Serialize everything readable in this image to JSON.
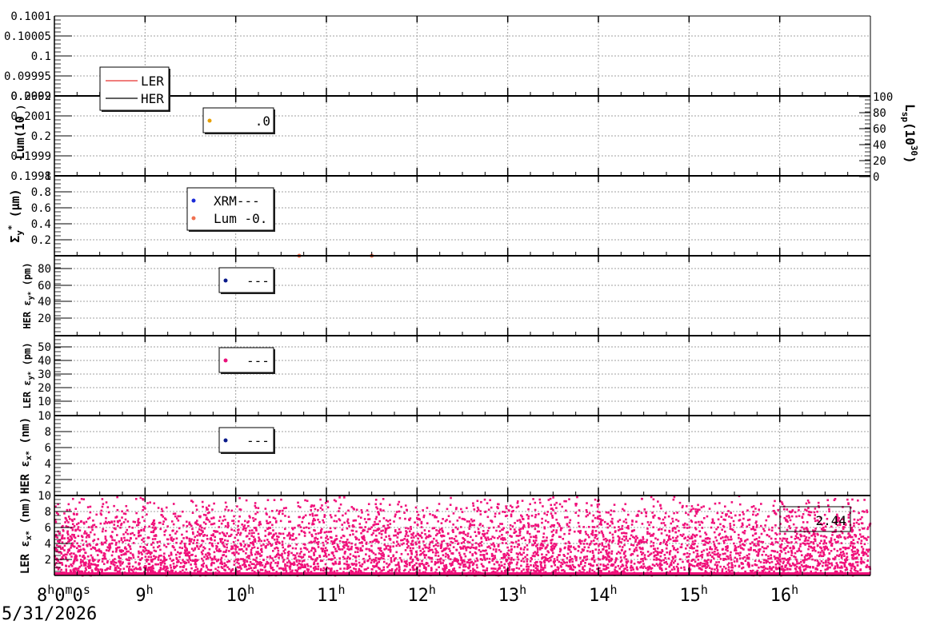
{
  "chart_data": {
    "type": "scatter",
    "x_axis": {
      "tick_labels": [
        "8",
        "9",
        "10",
        "11",
        "12",
        "13",
        "14",
        "15",
        "16"
      ],
      "first_label_suffix": "0m0s",
      "hour_unit": "h",
      "range_hours": [
        8,
        17
      ],
      "date": "5/31/2026"
    },
    "panels": [
      {
        "id": "p1",
        "ylabel": "",
        "yticks": [
          "0.1001",
          "0.10005",
          "0.1",
          "0.09995",
          "0.0999"
        ],
        "legend": {
          "entries": [
            {
              "label": "LER",
              "color": "#e8322d"
            },
            {
              "label": "HER",
              "color": "#000000"
            }
          ]
        }
      },
      {
        "id": "p2",
        "ylabel": "Lum(10",
        "ylabel_exp": "",
        "yticks": [
          "0.2002",
          "0.2001",
          "0.2",
          "0.1999",
          "0.1998"
        ],
        "right_axis": {
          "label_main": "L",
          "label_sub": "sp",
          "label_tail": "(10",
          "label_exp": "30",
          "label_end": ")",
          "ticks": [
            "100",
            "80",
            "60",
            "40",
            "20",
            "0"
          ]
        },
        "legend": {
          "entries": [
            {
              "label": ".0",
              "color": "#e8a000"
            }
          ]
        }
      },
      {
        "id": "p3",
        "ylabel": "Σ",
        "ylabel_sub": "y",
        "ylabel_sup": "*",
        "ylabel_unit": " (μm)",
        "yticks": [
          "1",
          "0.8",
          "0.6",
          "0.4",
          "0.2"
        ],
        "legend": {
          "entries": [
            {
              "label": "XRM---",
              "color": "#1a2ad8"
            },
            {
              "label": "Lum -0.",
              "color": "#f07050"
            }
          ]
        },
        "points": [
          {
            "x": 10.7,
            "y": 0.0,
            "color": "#f07050"
          },
          {
            "x": 11.5,
            "y": 0.0,
            "color": "#f07050"
          }
        ]
      },
      {
        "id": "p4",
        "ylabel_prefix": "HER ε",
        "ylabel_sub": "y*",
        "ylabel_unit": " (pm)",
        "yticks": [
          "80",
          "60",
          "40",
          "20"
        ],
        "legend": {
          "entries": [
            {
              "label": "---",
              "color": "#0a1a8a"
            }
          ]
        }
      },
      {
        "id": "p5",
        "ylabel_prefix": "LER ε",
        "ylabel_sub": "y*",
        "ylabel_unit": " (pm)",
        "yticks": [
          "50",
          "40",
          "30",
          "20",
          "10"
        ],
        "legend": {
          "entries": [
            {
              "label": "---",
              "color": "#e8107a"
            }
          ]
        }
      },
      {
        "id": "p6",
        "ylabel_prefix": "HER ε",
        "ylabel_sub": "x*",
        "ylabel_unit": " (nm)",
        "yticks": [
          "10",
          "8",
          "6",
          "4",
          "2"
        ],
        "legend": {
          "entries": [
            {
              "label": "---",
              "color": "#0a1a8a"
            }
          ]
        }
      },
      {
        "id": "p7",
        "ylabel_prefix": "LER ε",
        "ylabel_sub": "x*",
        "ylabel_unit": " (nm)",
        "yticks": [
          "10",
          "8",
          "6",
          "4",
          "2"
        ],
        "legend": {
          "entries": [
            {
              "label": "2.44",
              "color": "#e8107a"
            }
          ]
        },
        "scatter_color": "#f0107a",
        "scatter_y_range": [
          0,
          10
        ],
        "scatter_note": "dense random scatter filling the panel, denser near the top"
      }
    ]
  }
}
